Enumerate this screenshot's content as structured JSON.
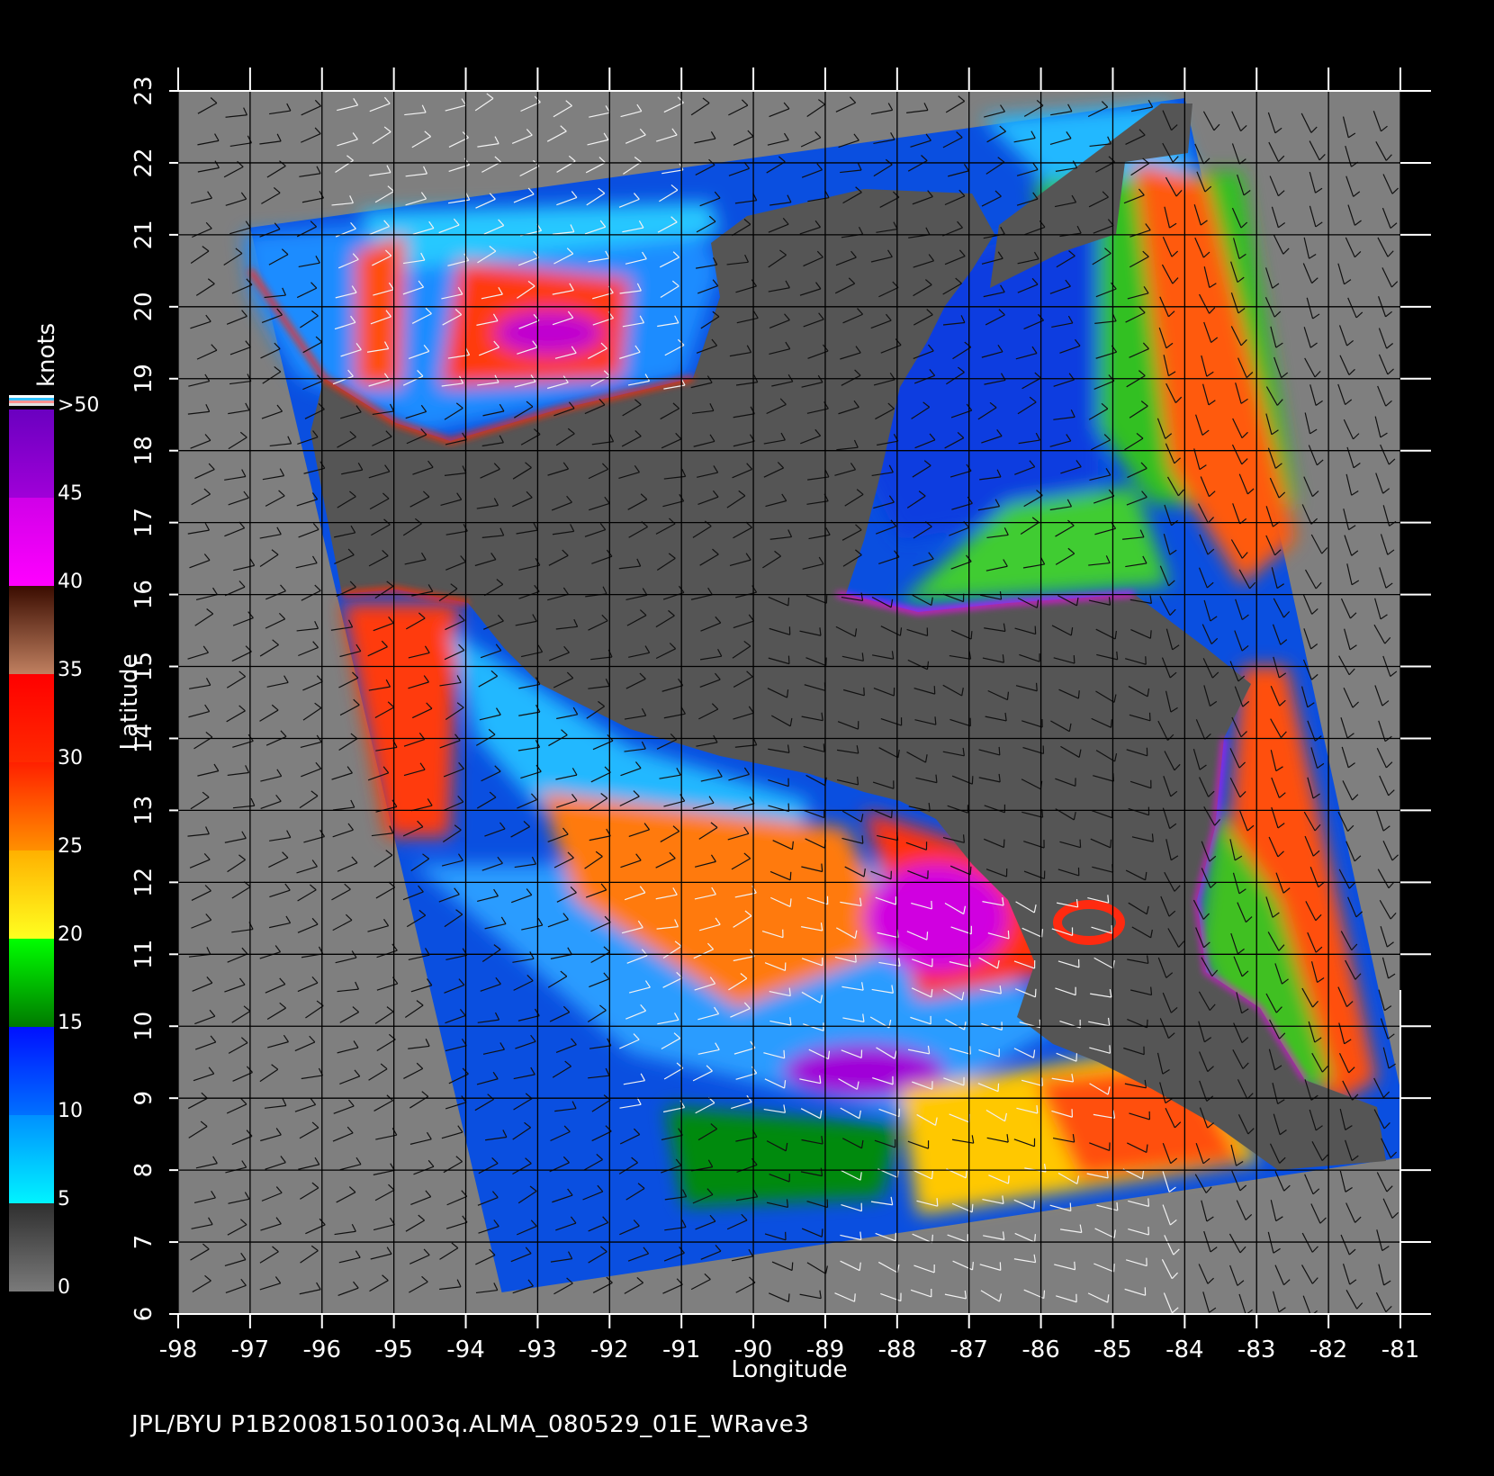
{
  "title": "JPL/BYU  P1B20081501003q.ALMA_080529_01E_WRave3",
  "colorbar": {
    "unit_label": "knots",
    "ticks": [
      "0",
      "5",
      "10",
      "15",
      "20",
      "25",
      "30",
      "35",
      "40",
      "45",
      ">50"
    ],
    "bands": [
      {
        "from": 0,
        "to": 5,
        "colors": [
          "#7a7a7a",
          "#2f2f2f"
        ]
      },
      {
        "from": 5,
        "to": 10,
        "colors": [
          "#00f4ff",
          "#0090ff"
        ]
      },
      {
        "from": 10,
        "to": 15,
        "colors": [
          "#0070ff",
          "#0010ff"
        ]
      },
      {
        "from": 15,
        "to": 20,
        "colors": [
          "#007a00",
          "#00ff00"
        ]
      },
      {
        "from": 20,
        "to": 25,
        "colors": [
          "#ffff20",
          "#ffb000"
        ]
      },
      {
        "from": 25,
        "to": 30,
        "colors": [
          "#ff9000",
          "#ff2000"
        ]
      },
      {
        "from": 30,
        "to": 35,
        "colors": [
          "#ff2a00",
          "#ff0000"
        ]
      },
      {
        "from": 35,
        "to": 40,
        "colors": [
          "#c08060",
          "#3a0c00"
        ]
      },
      {
        "from": 40,
        "to": 45,
        "colors": [
          "#ff00ff",
          "#d000e8"
        ]
      },
      {
        "from": 45,
        "to": 50,
        "colors": [
          "#a000d8",
          "#6a00c0"
        ]
      }
    ]
  },
  "chart_data": {
    "type": "map",
    "xlabel": "Longitude",
    "ylabel": "Latitude",
    "xlim": [
      -98,
      -81
    ],
    "ylim": [
      6,
      23
    ],
    "x_ticks": [
      "-98",
      "-97",
      "-96",
      "-95",
      "-94",
      "-93",
      "-92",
      "-91",
      "-90",
      "-89",
      "-88",
      "-87",
      "-86",
      "-85",
      "-84",
      "-83",
      "-82",
      "-81"
    ],
    "y_ticks": [
      "6",
      "7",
      "8",
      "9",
      "10",
      "11",
      "12",
      "13",
      "14",
      "15",
      "16",
      "17",
      "18",
      "19",
      "20",
      "21",
      "22",
      "23"
    ],
    "grid": true,
    "swath_corners": [
      [
        -97.0,
        21.1
      ],
      [
        -84.0,
        22.9
      ],
      [
        -80.8,
        8.2
      ],
      [
        -93.5,
        6.3
      ]
    ],
    "colors": {
      "background": "#000000",
      "outside_swath": "#7f7f7f",
      "land": "#555555",
      "grid": "#000000",
      "axes": "#ffffff"
    }
  }
}
